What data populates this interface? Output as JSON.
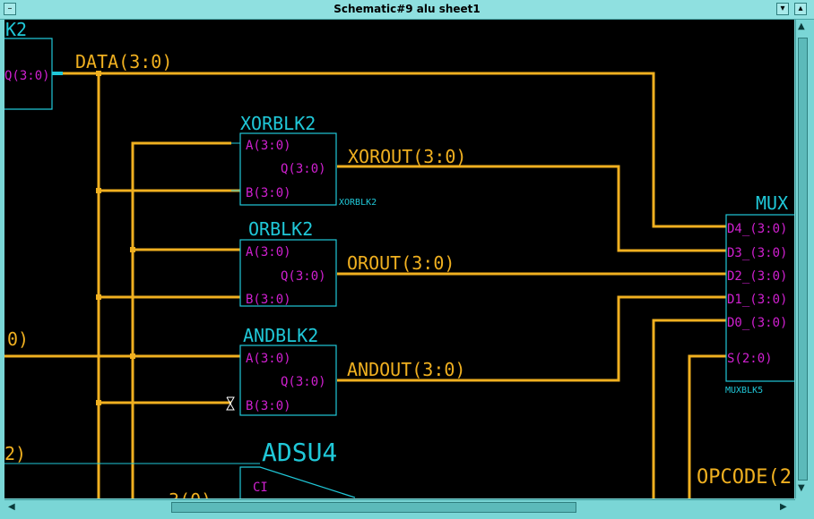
{
  "window": {
    "title": "Schematic#9 alu sheet1"
  },
  "colors": {
    "wire": "#f0b020",
    "symbol": "#20c8d8",
    "pin": "#d020d0",
    "net_label": "#f0b020",
    "background": "#000000"
  },
  "icons": {
    "close": "close-icon",
    "minimize": "minimize-icon",
    "maximize": "maximize-icon",
    "scroll_left": "arrow-left-icon",
    "scroll_right": "arrow-right-icon",
    "scroll_up": "arrow-up-icon",
    "scroll_down": "arrow-down-icon"
  },
  "schematic": {
    "left_block": {
      "name_fragment": "K2",
      "pin": "Q(3:0)"
    },
    "nets": {
      "data": "DATA(3:0)",
      "xorout": "XOROUT(3:0)",
      "orout": "OROUT(3:0)",
      "andout": "ANDOUT(3:0)",
      "left_mid": "0)",
      "left_low": "2)",
      "opcode": "OPCODE(2",
      "bottom_frag": "3(0)"
    },
    "blocks": {
      "xor": {
        "name": "XORBLK2",
        "type": "XORBLK2",
        "pin_a": "A(3:0)",
        "pin_b": "B(3:0)",
        "pin_q": "Q(3:0)"
      },
      "or": {
        "name": "ORBLK2",
        "pin_a": "A(3:0)",
        "pin_b": "B(3:0)",
        "pin_q": "Q(3:0)"
      },
      "and": {
        "name": "ANDBLK2",
        "pin_a": "A(3:0)",
        "pin_b": "B(3:0)",
        "pin_q": "Q(3:0)"
      },
      "mux": {
        "name": "MUX",
        "type": "MUXBLK5",
        "pins": [
          "D4_(3:0)",
          "D3_(3:0)",
          "D2_(3:0)",
          "D1_(3:0)",
          "D0_(3:0)",
          "S(2:0)"
        ]
      },
      "adsu": {
        "name": "ADSU4",
        "pin_ci": "CI"
      }
    }
  }
}
